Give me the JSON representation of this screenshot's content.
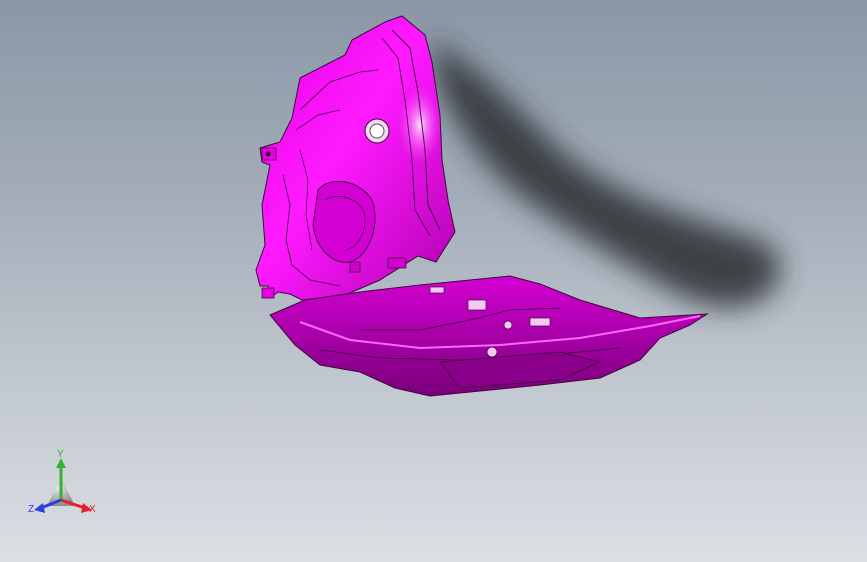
{
  "viewport": {
    "background_top": "#8b97a6",
    "background_bottom": "#dcdfe4"
  },
  "model": {
    "part_color": "#ff00ff",
    "edge_color": "#3a0a3a",
    "shadow_color": "#2b2e33"
  },
  "triad": {
    "x_label": "X",
    "y_label": "Y",
    "z_label": "Z",
    "x_color": "#e0202a",
    "y_color": "#2fb52f",
    "z_color": "#2a3fe0"
  }
}
